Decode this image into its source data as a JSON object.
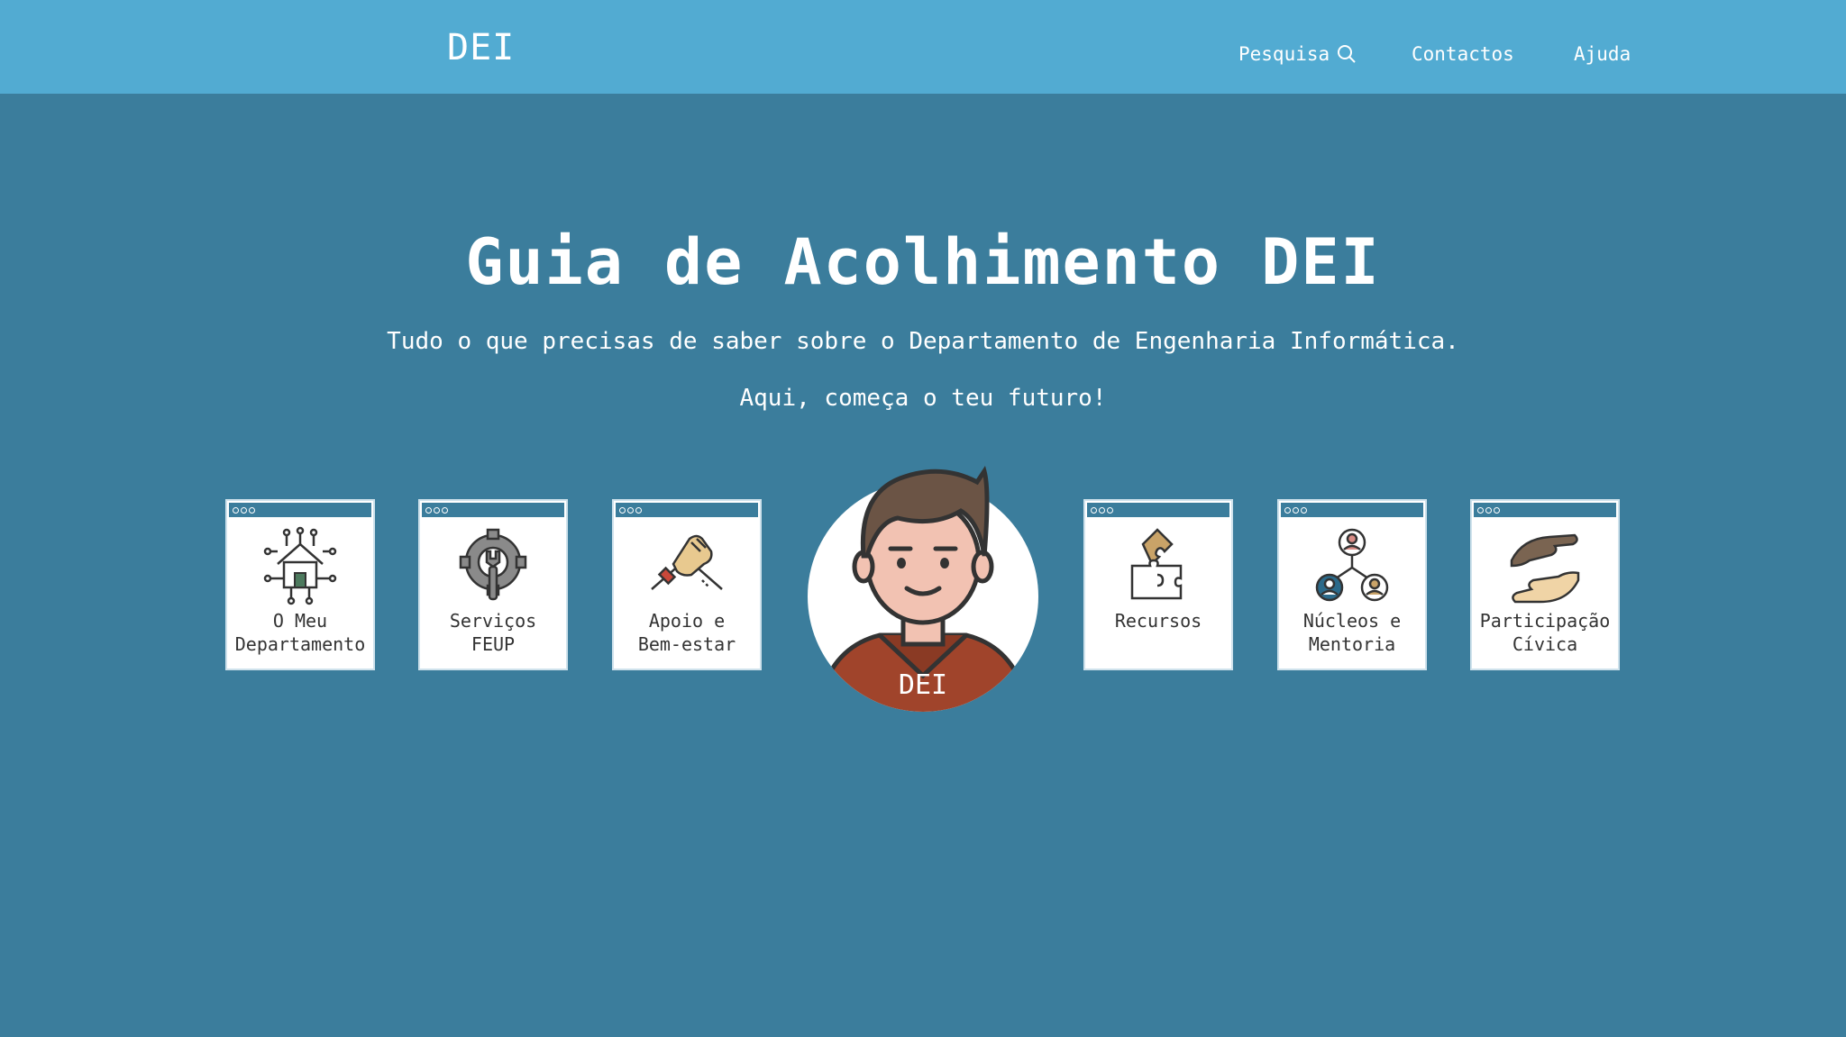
{
  "header": {
    "brand": "DEI",
    "nav": {
      "search": "Pesquisa",
      "contacts": "Contactos",
      "help": "Ajuda"
    }
  },
  "hero": {
    "title": "Guia de Acolhimento DEI",
    "subtitle": "Tudo o que precisas de saber sobre o Departamento de Engenharia Informática.",
    "tagline": "Aqui, começa o teu futuro!"
  },
  "cards": [
    {
      "line1": "O Meu",
      "line2": "Departamento",
      "icon": "house-circuit-icon"
    },
    {
      "line1": "Serviços",
      "line2": "FEUP",
      "icon": "gear-wrench-icon"
    },
    {
      "line1": "Apoio e",
      "line2": "Bem-estar",
      "icon": "handshake-icon"
    },
    {
      "line1": "Recursos",
      "line2": "",
      "icon": "puzzle-icon"
    },
    {
      "line1": "Núcleos e",
      "line2": "Mentoria",
      "icon": "network-people-icon"
    },
    {
      "line1": "Participação",
      "line2": "Cívica",
      "icon": "helping-hands-icon"
    }
  ],
  "avatar": {
    "label": "DEI",
    "icon": "student-avatar-icon"
  },
  "colors": {
    "background": "#3b7d9c",
    "header": "#52abd2",
    "shirt": "#a0442b"
  }
}
